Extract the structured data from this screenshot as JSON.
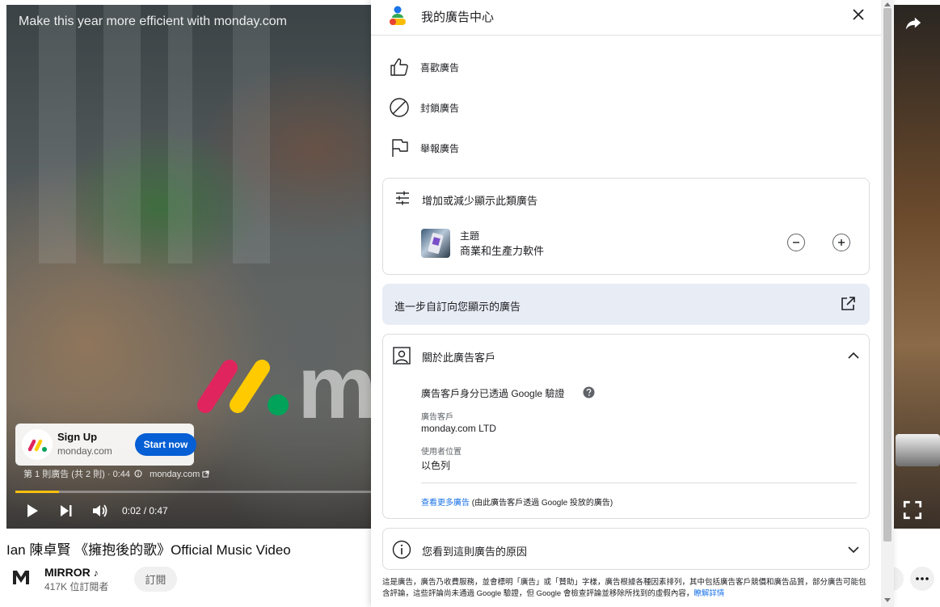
{
  "video": {
    "title": "Make this year more efficient with monday.com",
    "ad_card": {
      "cta_title": "Sign Up",
      "cta_sub": "monday.com",
      "cta_button": "Start now"
    },
    "ad_info": "第 1 則廣告 (共 2 則) · 0:44",
    "ad_domain": "monday.com",
    "time": "0:02 / 0:47",
    "progress": 0.12,
    "brand_text": "m"
  },
  "below": {
    "song_title": "Ian 陳卓賢 《擁抱後的歌》Official Music Video",
    "channel_name": "MIRROR",
    "channel_subs": "417K 位訂閱者",
    "subscribe": "訂閱"
  },
  "panel": {
    "title": "我的廣告中心",
    "actions": [
      {
        "label": "喜歡廣告",
        "icon": "thumbs-up-icon"
      },
      {
        "label": "封鎖廣告",
        "icon": "block-icon"
      },
      {
        "label": "舉報廣告",
        "icon": "flag-icon"
      }
    ],
    "topics_card": {
      "header": "增加或減少顯示此類廣告",
      "topic_label": "主題",
      "topic_value": "商業和生產力軟件"
    },
    "customize": "進一步自訂向您顯示的廣告",
    "advertiser_card": {
      "header": "關於此廣告客戶",
      "verified": "廣告客戶身分已透過 Google 驗證",
      "advertiser_label": "廣告客戶",
      "advertiser_value": "monday.com LTD",
      "location_label": "使用者位置",
      "location_value": "以色列",
      "more_link": "查看更多廣告",
      "more_suffix": " (由此廣告客戶透過 Google 投放的廣告)"
    },
    "why_card": {
      "header": "您看到這則廣告的原因"
    },
    "disclaimer_text": "這是廣告，廣告乃收費服務，並會標明「廣告」或「贊助」字樣，廣告根據各種因素排列，其中包括廣告客戶競價和廣告品質，部分廣告可能包含評論，這些評論尚未通過 Google 驗證，但 Google 會檢查評論並移除所找到的虛假內容，",
    "disclaimer_link": "瞭解詳情"
  },
  "colors": {
    "accent_blue": "#1a73e8",
    "cta_blue": "#065fd4",
    "progress_yellow": "#fcc00f",
    "customize_bg": "#e8ecf5"
  }
}
